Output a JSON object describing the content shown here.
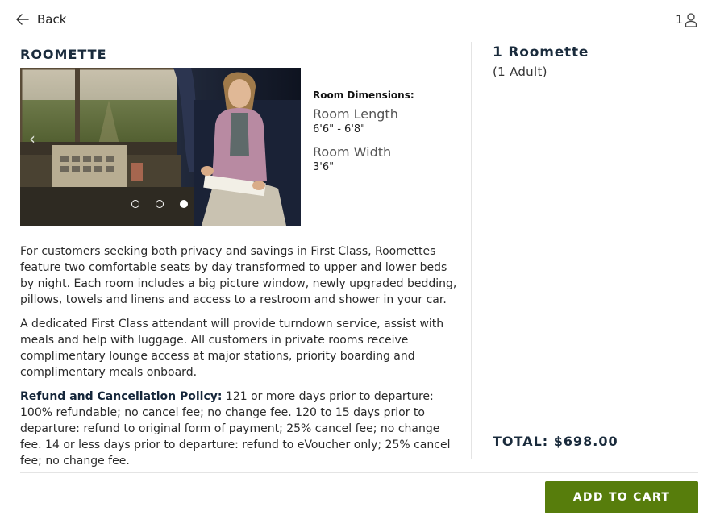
{
  "nav": {
    "back_label": "Back",
    "traveler_count": "1"
  },
  "room": {
    "title": "ROOMETTE",
    "dimensions_label": "Room Dimensions:",
    "length_label": "Room Length",
    "length_value": "6'6\" - 6'8\"",
    "width_label": "Room Width",
    "width_value": "3'6\"",
    "gallery": {
      "slide_count": 3,
      "active_slide": 3
    }
  },
  "description": {
    "p1": "For customers seeking both privacy and savings in First Class, Roomettes feature two comfortable seats by day transformed to upper and lower beds by night. Each room includes a big picture window, newly upgraded bedding, pillows, towels and linens and access to a restroom and shower in your car.",
    "p2": "A dedicated First Class attendant will provide turndown service, assist with meals and help with luggage. All customers in private rooms receive complimentary lounge access at major stations, priority boarding and complimentary meals onboard.",
    "policy_label": "Refund and Cancellation Policy:",
    "policy_text": " 121 or more days prior to departure: 100% refundable; no cancel fee; no change fee. 120 to 15 days prior to departure: refund to original form of payment; 25% cancel fee; no change fee. 14 or less days prior to departure: refund to eVoucher only; 25% cancel fee; no change fee."
  },
  "summary": {
    "title": "1 Roomette",
    "subtitle": "(1 Adult)",
    "total": "TOTAL: $698.00"
  },
  "cart": {
    "button_label": "ADD TO CART"
  },
  "colors": {
    "button_bg": "#577d0c",
    "heading": "#1a2b3c"
  }
}
